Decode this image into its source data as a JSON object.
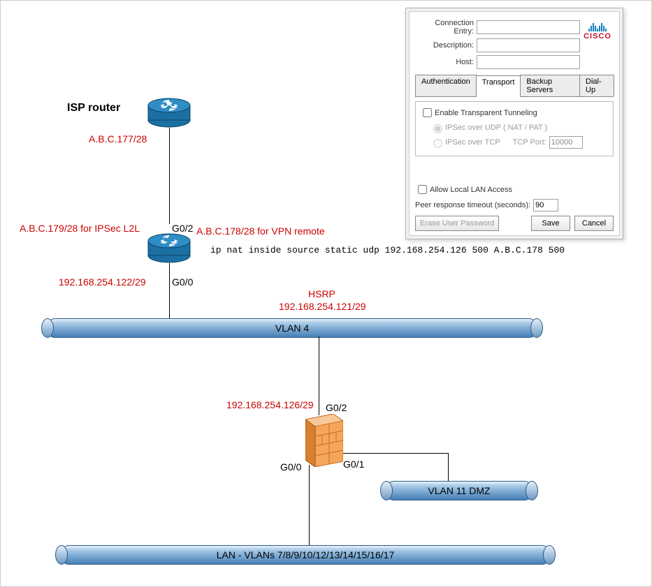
{
  "diagram": {
    "isp_router_label": "ISP router",
    "isp_router_ip": "A.B.C.177/28",
    "edge_router": {
      "ipsec_l2l": "A.B.C.179/28 for IPSec L2L",
      "vpn_remote": "A.B.C.178/28 for VPN remote",
      "g02": "G0/2",
      "g00": "G0/0",
      "inside_ip": "192.168.254.122/29",
      "nat_cmd": "ip nat inside source static udp 192.168.254.126 500 A.B.C.178 500"
    },
    "hsrp_label": "HSRP",
    "hsrp_ip": "192.168.254.121/29",
    "vlan4_label": "VLAN 4",
    "firewall": {
      "top_ip": "192.168.254.126/29",
      "g02": "G0/2",
      "g00": "G0/0",
      "g01": "G0/1"
    },
    "vlan11_label": "VLAN 11 DMZ",
    "lan_label": "LAN - VLANs 7/8/9/10/12/13/14/15/16/17"
  },
  "dialog": {
    "fields": {
      "conn_entry_label": "Connection Entry:",
      "conn_entry_value": "",
      "description_label": "Description:",
      "description_value": "",
      "host_label": "Host:",
      "host_value": ""
    },
    "tabs": {
      "auth": "Authentication",
      "transport": "Transport",
      "backup": "Backup Servers",
      "dialup": "Dial-Up"
    },
    "transport": {
      "enable_tt": "Enable Transparent Tunneling",
      "ipsec_udp": "IPSec over UDP ( NAT / PAT )",
      "ipsec_tcp": "IPSec over TCP",
      "tcp_port_label": "TCP Port:",
      "tcp_port_value": "10000",
      "allow_lan": "Allow Local LAN Access",
      "peer_timeout_label": "Peer response timeout (seconds):",
      "peer_timeout_value": "90"
    },
    "buttons": {
      "erase": "Erase User Password",
      "save": "Save",
      "cancel": "Cancel"
    },
    "logo_text": "CISCO"
  }
}
